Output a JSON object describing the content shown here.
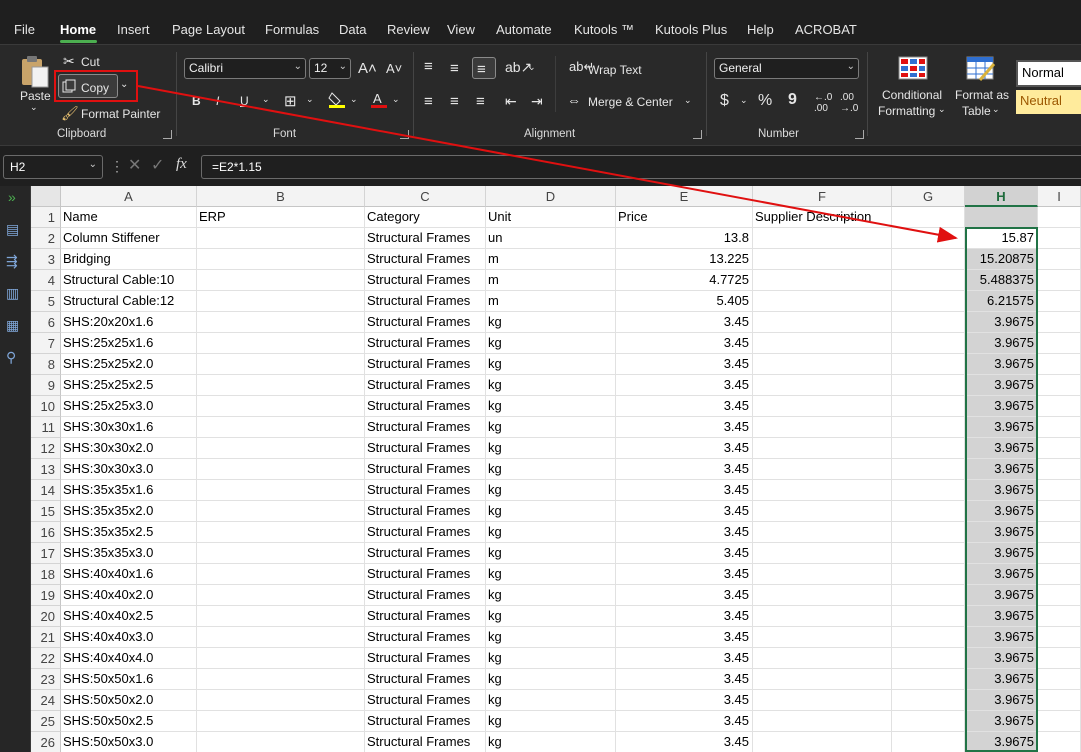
{
  "menu": {
    "tabs": [
      "File",
      "Home",
      "Insert",
      "Page Layout",
      "Formulas",
      "Data",
      "Review",
      "View",
      "Automate",
      "Kutools ™",
      "Kutools Plus",
      "Help",
      "ACROBAT"
    ],
    "active": "Home"
  },
  "ribbon": {
    "clipboard": {
      "paste": "Paste",
      "cut": "Cut",
      "copy": "Copy",
      "format_painter": "Format Painter",
      "label": "Clipboard"
    },
    "font": {
      "family": "Calibri",
      "size": "12",
      "label": "Font",
      "bold": "B",
      "italic": "I",
      "underline": "U"
    },
    "alignment": {
      "wrap_text": "Wrap Text",
      "merge_center": "Merge & Center",
      "label": "Alignment"
    },
    "number": {
      "format": "General",
      "label": "Number",
      "currency": "$",
      "percent": "%",
      "comma": "9"
    },
    "styles": {
      "conditional_formatting_1": "Conditional",
      "conditional_formatting_2": "Formatting",
      "format_as_table_1": "Format as",
      "format_as_table_2": "Table",
      "normal": "Normal",
      "neutral": "Neutral"
    }
  },
  "formula_bar": {
    "name_box": "H2",
    "formula": "=E2*1.15"
  },
  "grid": {
    "columns": [
      "A",
      "B",
      "C",
      "D",
      "E",
      "F",
      "G",
      "H",
      "I"
    ],
    "selected_column": "H",
    "headers": {
      "name": "Name",
      "erp": "ERP",
      "category": "Category",
      "unit": "Unit",
      "price": "Price",
      "supplier": "Supplier Description"
    },
    "rows": [
      {
        "n": "2",
        "name": "Column Stiffener",
        "category": "Structural Frames",
        "unit": "un",
        "price": "13.8",
        "h": "15.87"
      },
      {
        "n": "3",
        "name": "Bridging",
        "category": "Structural Frames",
        "unit": "m",
        "price": "13.225",
        "h": "15.20875"
      },
      {
        "n": "4",
        "name": "Structural Cable:10",
        "category": "Structural Frames",
        "unit": "m",
        "price": "4.7725",
        "h": "5.488375"
      },
      {
        "n": "5",
        "name": "Structural Cable:12",
        "category": "Structural Frames",
        "unit": "m",
        "price": "5.405",
        "h": "6.21575"
      },
      {
        "n": "6",
        "name": "SHS:20x20x1.6",
        "category": "Structural Frames",
        "unit": "kg",
        "price": "3.45",
        "h": "3.9675"
      },
      {
        "n": "7",
        "name": "SHS:25x25x1.6",
        "category": "Structural Frames",
        "unit": "kg",
        "price": "3.45",
        "h": "3.9675"
      },
      {
        "n": "8",
        "name": "SHS:25x25x2.0",
        "category": "Structural Frames",
        "unit": "kg",
        "price": "3.45",
        "h": "3.9675"
      },
      {
        "n": "9",
        "name": "SHS:25x25x2.5",
        "category": "Structural Frames",
        "unit": "kg",
        "price": "3.45",
        "h": "3.9675"
      },
      {
        "n": "10",
        "name": "SHS:25x25x3.0",
        "category": "Structural Frames",
        "unit": "kg",
        "price": "3.45",
        "h": "3.9675"
      },
      {
        "n": "11",
        "name": "SHS:30x30x1.6",
        "category": "Structural Frames",
        "unit": "kg",
        "price": "3.45",
        "h": "3.9675"
      },
      {
        "n": "12",
        "name": "SHS:30x30x2.0",
        "category": "Structural Frames",
        "unit": "kg",
        "price": "3.45",
        "h": "3.9675"
      },
      {
        "n": "13",
        "name": "SHS:30x30x3.0",
        "category": "Structural Frames",
        "unit": "kg",
        "price": "3.45",
        "h": "3.9675"
      },
      {
        "n": "14",
        "name": "SHS:35x35x1.6",
        "category": "Structural Frames",
        "unit": "kg",
        "price": "3.45",
        "h": "3.9675"
      },
      {
        "n": "15",
        "name": "SHS:35x35x2.0",
        "category": "Structural Frames",
        "unit": "kg",
        "price": "3.45",
        "h": "3.9675"
      },
      {
        "n": "16",
        "name": "SHS:35x35x2.5",
        "category": "Structural Frames",
        "unit": "kg",
        "price": "3.45",
        "h": "3.9675"
      },
      {
        "n": "17",
        "name": "SHS:35x35x3.0",
        "category": "Structural Frames",
        "unit": "kg",
        "price": "3.45",
        "h": "3.9675"
      },
      {
        "n": "18",
        "name": "SHS:40x40x1.6",
        "category": "Structural Frames",
        "unit": "kg",
        "price": "3.45",
        "h": "3.9675"
      },
      {
        "n": "19",
        "name": "SHS:40x40x2.0",
        "category": "Structural Frames",
        "unit": "kg",
        "price": "3.45",
        "h": "3.9675"
      },
      {
        "n": "20",
        "name": "SHS:40x40x2.5",
        "category": "Structural Frames",
        "unit": "kg",
        "price": "3.45",
        "h": "3.9675"
      },
      {
        "n": "21",
        "name": "SHS:40x40x3.0",
        "category": "Structural Frames",
        "unit": "kg",
        "price": "3.45",
        "h": "3.9675"
      },
      {
        "n": "22",
        "name": "SHS:40x40x4.0",
        "category": "Structural Frames",
        "unit": "kg",
        "price": "3.45",
        "h": "3.9675"
      },
      {
        "n": "23",
        "name": "SHS:50x50x1.6",
        "category": "Structural Frames",
        "unit": "kg",
        "price": "3.45",
        "h": "3.9675"
      },
      {
        "n": "24",
        "name": "SHS:50x50x2.0",
        "category": "Structural Frames",
        "unit": "kg",
        "price": "3.45",
        "h": "3.9675"
      },
      {
        "n": "25",
        "name": "SHS:50x50x2.5",
        "category": "Structural Frames",
        "unit": "kg",
        "price": "3.45",
        "h": "3.9675"
      },
      {
        "n": "26",
        "name": "SHS:50x50x3.0",
        "category": "Structural Frames",
        "unit": "kg",
        "price": "3.45",
        "h": "3.9675"
      }
    ]
  },
  "colors": {
    "accent_green": "#217346",
    "annotation_red": "#e01010"
  }
}
